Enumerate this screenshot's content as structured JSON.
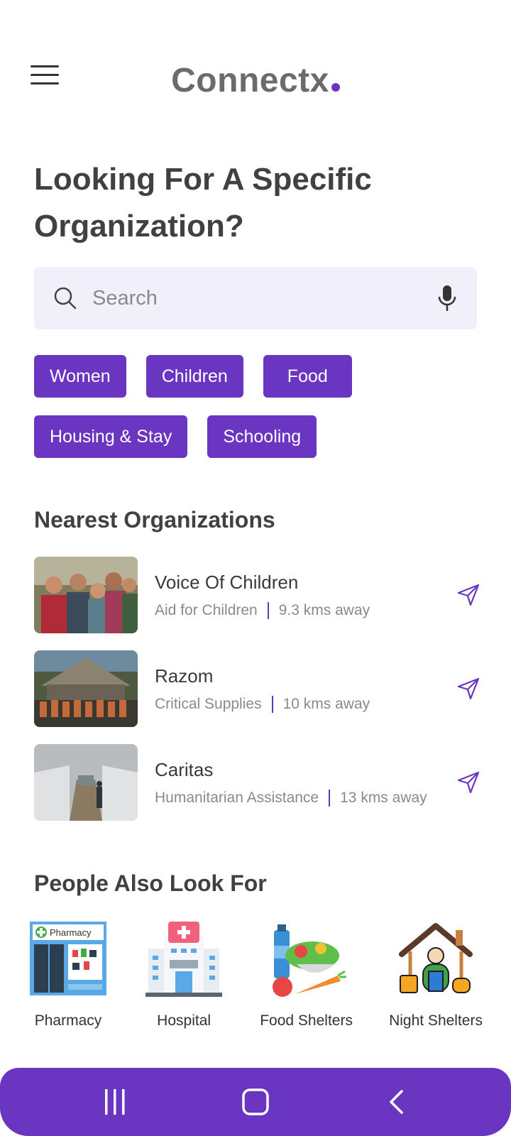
{
  "app": {
    "logo_text": "Connectx",
    "accent_color": "#6a35c0"
  },
  "header": {
    "menu_icon": "hamburger-menu-icon"
  },
  "headline": "Looking For A Specific Organization?",
  "search": {
    "placeholder": "Search",
    "value": "",
    "left_icon": "search-icon",
    "right_icon": "microphone-icon"
  },
  "chips": [
    {
      "label": "Women"
    },
    {
      "label": "Children"
    },
    {
      "label": "Food"
    },
    {
      "label": "Housing & Stay"
    },
    {
      "label": "Schooling"
    }
  ],
  "nearest": {
    "title": "Nearest Organizations",
    "items": [
      {
        "name": "Voice Of Children",
        "category": "Aid for Children",
        "distance": "9.3 kms away"
      },
      {
        "name": "Razom",
        "category": "Critical Supplies",
        "distance": "10 kms away"
      },
      {
        "name": "Caritas",
        "category": "Humanitarian Assistance",
        "distance": "13 kms away"
      }
    ]
  },
  "also": {
    "title": "People Also Look For",
    "items": [
      {
        "label": "Pharmacy",
        "icon": "pharmacy-icon",
        "sign": "Pharmacy"
      },
      {
        "label": "Hospital",
        "icon": "hospital-icon"
      },
      {
        "label": "Food Shelters",
        "icon": "food-shelter-icon"
      },
      {
        "label": "Night Shelters",
        "icon": "night-shelter-icon"
      }
    ]
  },
  "system_nav": {
    "recents_icon": "recents-icon",
    "home_icon": "home-icon",
    "back_icon": "back-icon"
  }
}
